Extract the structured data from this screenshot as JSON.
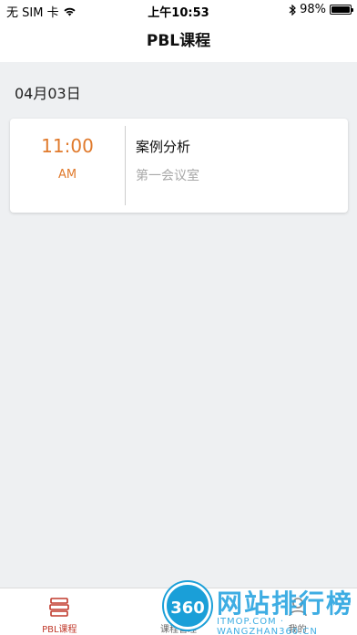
{
  "status_bar": {
    "carrier": "无 SIM 卡",
    "time": "上午10:53",
    "battery_text": "98%",
    "battery_level": 0.98
  },
  "nav": {
    "title": "PBL课程"
  },
  "schedule": {
    "date": "04月03日",
    "courses": [
      {
        "time": "11:00",
        "ampm": "AM",
        "title": "案例分析",
        "room": "第一会议室"
      }
    ]
  },
  "tab_bar": {
    "items": [
      {
        "label": "PBL课程",
        "icon": "books-icon",
        "active": true
      },
      {
        "label": "课程管理",
        "icon": "document-icon",
        "active": false
      },
      {
        "label": "我的",
        "icon": "person-icon",
        "active": false
      }
    ]
  },
  "watermark": {
    "badge": "360",
    "text": "网站排行榜",
    "site": "ITMOP.COM",
    "subline": "WANGZHAN360.CN"
  },
  "colors": {
    "accent": "#e07a2c",
    "tab_active": "#c0392b",
    "content_bg": "#eef0f2",
    "watermark": "#2aa5e0"
  }
}
